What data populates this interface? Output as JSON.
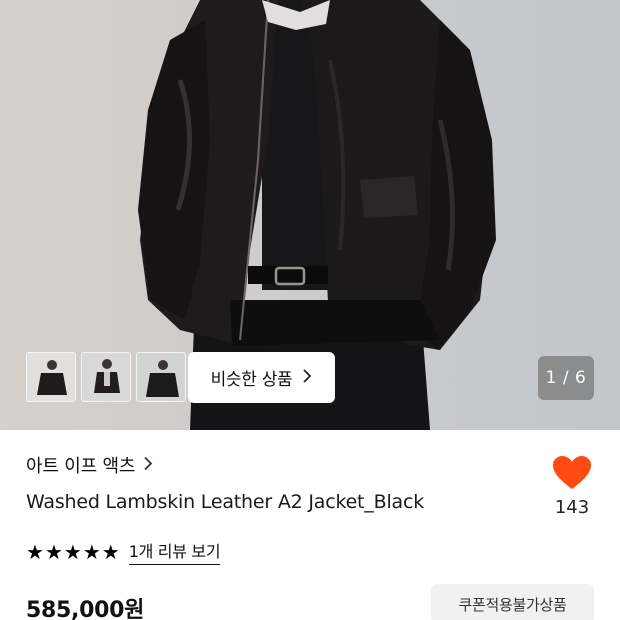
{
  "gallery": {
    "similar_products_label": "비슷한 상품",
    "pager_text": "1 / 6",
    "thumbnails": [
      "thumbnail-1",
      "thumbnail-2",
      "thumbnail-3"
    ]
  },
  "product": {
    "brand": "아트 이프 액츠",
    "name": "Washed Lambskin Leather A2 Jacket_Black",
    "like_count": "143",
    "rating": 5,
    "review_link": "1개 리뷰 보기",
    "price": "585,000원",
    "coupon_badge": "쿠폰적용불가상품"
  },
  "colors": {
    "heart": "#ff4b12",
    "star": "#000000"
  }
}
